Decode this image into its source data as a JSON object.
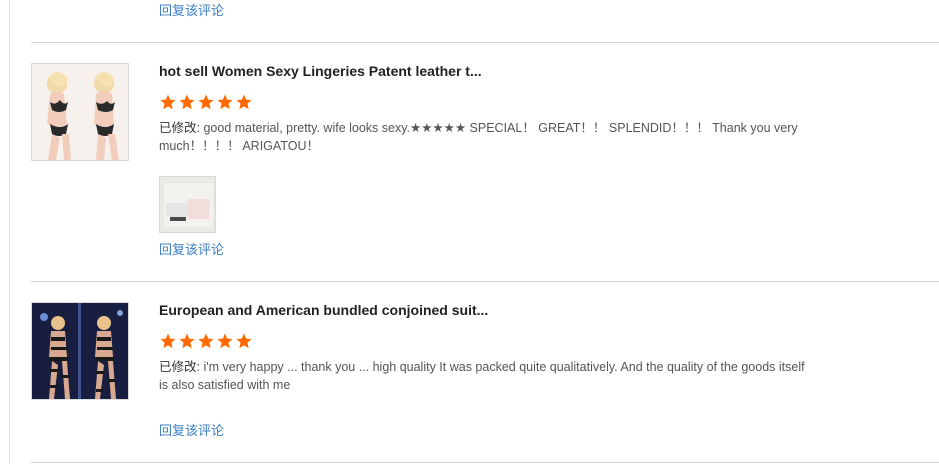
{
  "colors": {
    "accent_star": "#ff6a00",
    "link": "#3b7fc4"
  },
  "reply_label": "回复该评论",
  "reviews": [
    {
      "product_title": "hot sell Women Sexy Lingeries Patent leather t...",
      "rating": 5,
      "edited_tag": "已修改:",
      "text": " good material, pretty. wife looks sexy.★★★★★ SPECIAL！ GREAT！！ SPLENDID！！！ Thank you very much！！！！ ARIGATOU！",
      "has_photo": true
    },
    {
      "product_title": "European and American bundled conjoined suit...",
      "rating": 5,
      "edited_tag": "已修改:",
      "text": " i'm very happy ... thank you ... high quality It was packed quite qualitatively. And the quality of the goods itself is also satisfied with me",
      "has_photo": false
    }
  ]
}
